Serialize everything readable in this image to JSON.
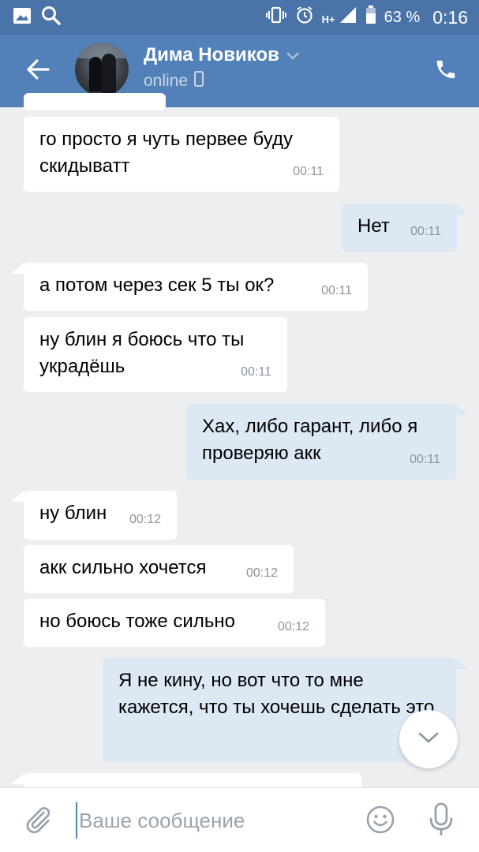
{
  "status_bar": {
    "network": "H+",
    "battery": "63 %",
    "time": "0:16"
  },
  "header": {
    "contact_name": "Дима Новиков",
    "status": "online"
  },
  "messages": [
    {
      "dir": "in",
      "text": "го просто я чуть первее буду скидыватт",
      "time": "00:11"
    },
    {
      "dir": "out",
      "text": "Нет",
      "time": "00:11"
    },
    {
      "dir": "in",
      "text": "а потом через сек 5 ты ок?",
      "time": "00:11"
    },
    {
      "dir": "in",
      "text": "ну блин я боюсь что ты украдёшь",
      "time": "00:11"
    },
    {
      "dir": "out",
      "text": "Хах, либо гарант, либо я проверяю акк",
      "time": "00:11"
    },
    {
      "dir": "in",
      "text": "ну блин",
      "time": "00:12"
    },
    {
      "dir": "in",
      "text": "акк сильно хочется",
      "time": "00:12"
    },
    {
      "dir": "in",
      "text": "но боюсь тоже сильно",
      "time": "00:12"
    },
    {
      "dir": "out",
      "text": "Я не кину, но вот что то мне кажется, что ты хочешь сделать это",
      "time": ""
    }
  ],
  "composer": {
    "placeholder": "Ваше сообщение",
    "value": ""
  },
  "colors": {
    "header_bg": "#5181b8",
    "status_bg": "#4a73a7",
    "chat_bg": "#edeef0",
    "incoming_bubble": "#ffffff",
    "outgoing_bubble": "#dde8f5",
    "time_text": "#8a949e"
  },
  "icons": [
    "gallery-icon",
    "search-icon",
    "vibrate-icon",
    "alarm-icon",
    "signal-icon",
    "battery-icon",
    "back-arrow-icon",
    "chevron-down-icon",
    "mobile-icon",
    "phone-icon",
    "attach-icon",
    "emoji-icon",
    "mic-icon"
  ]
}
